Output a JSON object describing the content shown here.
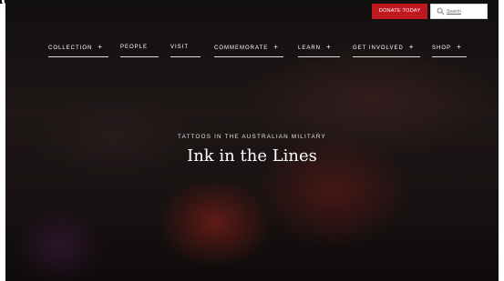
{
  "clipped_heading": "ity",
  "utility": {
    "donate_label": "DONATE TODAY",
    "search_placeholder": "Search",
    "donate_color": "#c0181f"
  },
  "nav": {
    "items": [
      {
        "label": "COLLECTION",
        "has_plus": true,
        "plus": "+"
      },
      {
        "label": "PEOPLE",
        "has_plus": false
      },
      {
        "label": "VISIT",
        "has_plus": false
      },
      {
        "label": "COMMEMORATE",
        "has_plus": true,
        "plus": "+"
      },
      {
        "label": "LEARN",
        "has_plus": true,
        "plus": "+"
      },
      {
        "label": "GET INVOLVED",
        "has_plus": true,
        "plus": "+"
      },
      {
        "label": "SHOP",
        "has_plus": true,
        "plus": "+"
      }
    ]
  },
  "hero": {
    "kicker": "TATTOOS IN THE AUSTRALIAN MILITARY",
    "title": "Ink in the Lines"
  }
}
